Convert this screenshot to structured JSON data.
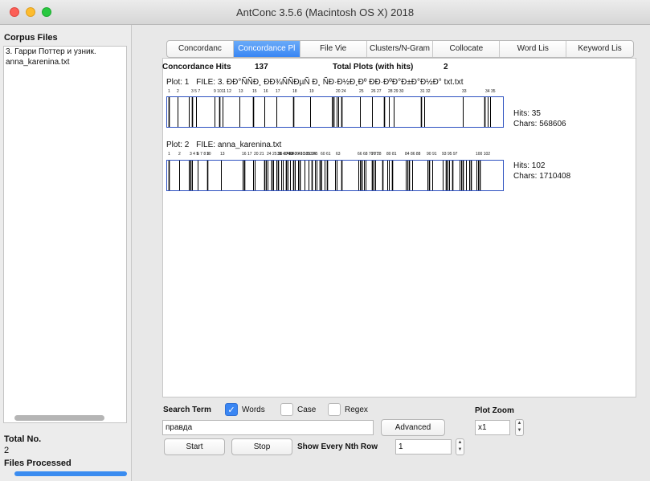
{
  "window": {
    "title": "AntConc 3.5.6 (Macintosh OS X) 2018"
  },
  "sidebar": {
    "header": "Corpus Files",
    "files": [
      "3. Гарри Поттер и узник.",
      "anna_karenina.txt"
    ],
    "total_label": "Total No.",
    "total_value": "2",
    "processed_label": "Files Processed",
    "progress_fraction": 1.0
  },
  "tabs": [
    {
      "label": "Concordanc"
    },
    {
      "label": "Concordance Pl"
    },
    {
      "label": "File Vie"
    },
    {
      "label": "Clusters/N-Gram"
    },
    {
      "label": "Collocate"
    },
    {
      "label": "Word Lis"
    },
    {
      "label": "Keyword Lis"
    }
  ],
  "active_tab_index": 1,
  "stats": {
    "hits_label": "Concordance Hits",
    "hits_value": "137",
    "plots_label": "Total Plots (with hits)",
    "plots_value": "2"
  },
  "plots": [
    {
      "plot_label": "Plot: 1",
      "file_label": "FILE: 3. ÐÐ°ÑÑÐ¸ ÐÐ¾ÑÑÐµÑ Ð¸ ÑÐ·Ð½Ð¸Ðº ÐÐ·ÐºÐ°Ð±Ð°Ð½Ð° txt.txt",
      "hits": "Hits: 35",
      "chars": "Chars: 568606",
      "chars_total": 568606,
      "ticks": [
        "1",
        "2",
        "3 5 7",
        "9 1011 12",
        "13",
        "15",
        "16",
        "17",
        "18",
        "19",
        "20 24",
        "25",
        "26 27",
        "28 29 30",
        "31 32",
        "33",
        "34 35"
      ],
      "tick_fracs": [
        0.005,
        0.03,
        0.075,
        0.14,
        0.215,
        0.255,
        0.29,
        0.325,
        0.375,
        0.425,
        0.505,
        0.575,
        0.61,
        0.66,
        0.755,
        0.88,
        0.95
      ],
      "hit_fracs": [
        0.005,
        0.03,
        0.065,
        0.075,
        0.085,
        0.14,
        0.155,
        0.165,
        0.215,
        0.255,
        0.29,
        0.325,
        0.375,
        0.425,
        0.49,
        0.495,
        0.505,
        0.51,
        0.52,
        0.575,
        0.61,
        0.645,
        0.66,
        0.675,
        0.755,
        0.765,
        0.88,
        0.945,
        0.955,
        0.962
      ]
    },
    {
      "plot_label": "Plot: 2",
      "file_label": "FILE: anna_karenina.txt",
      "hits": "Hits: 102",
      "chars": "Chars: 1710408",
      "chars_total": 1710408,
      "ticks": [
        "1",
        "2",
        "3 4 5",
        "6 7 8 9",
        "10",
        "13",
        "16 17",
        "20 21",
        "24 25 26 27 28 30 31 33 34",
        "38 40 43",
        "45 47 49 50",
        "53 55",
        "60 61",
        "63",
        "66 68 70 71",
        "76 78",
        "80 81",
        "84 86 88",
        "90 91",
        "93 95 97",
        "100 102"
      ],
      "tick_fracs": [
        0.005,
        0.035,
        0.07,
        0.09,
        0.12,
        0.16,
        0.225,
        0.26,
        0.3,
        0.33,
        0.36,
        0.42,
        0.46,
        0.505,
        0.57,
        0.61,
        0.655,
        0.71,
        0.775,
        0.82,
        0.92
      ],
      "hit_fracs": [
        0.005,
        0.035,
        0.065,
        0.07,
        0.075,
        0.09,
        0.12,
        0.16,
        0.225,
        0.23,
        0.255,
        0.26,
        0.29,
        0.295,
        0.3,
        0.31,
        0.315,
        0.325,
        0.33,
        0.34,
        0.345,
        0.355,
        0.36,
        0.365,
        0.375,
        0.38,
        0.39,
        0.395,
        0.41,
        0.42,
        0.43,
        0.44,
        0.445,
        0.455,
        0.46,
        0.47,
        0.475,
        0.5,
        0.505,
        0.52,
        0.57,
        0.575,
        0.58,
        0.585,
        0.59,
        0.61,
        0.615,
        0.62,
        0.64,
        0.655,
        0.66,
        0.67,
        0.71,
        0.715,
        0.72,
        0.73,
        0.775,
        0.78,
        0.79,
        0.82,
        0.83,
        0.835,
        0.84,
        0.85,
        0.87,
        0.875,
        0.88,
        0.89,
        0.9,
        0.905,
        0.92,
        0.925,
        0.93
      ]
    }
  ],
  "search": {
    "term_label": "Search Term",
    "words_label": "Words",
    "words_checked": true,
    "case_label": "Case",
    "case_checked": false,
    "regex_label": "Regex",
    "regex_checked": false,
    "term_value": "правда",
    "advanced_label": "Advanced",
    "start_label": "Start",
    "stop_label": "Stop",
    "nth_label": "Show Every Nth Row",
    "nth_value": "1",
    "zoom_label": "Plot Zoom",
    "zoom_value": "x1"
  },
  "colors": {
    "accent": "#3a86f3",
    "plot_border": "#2d51c0"
  }
}
